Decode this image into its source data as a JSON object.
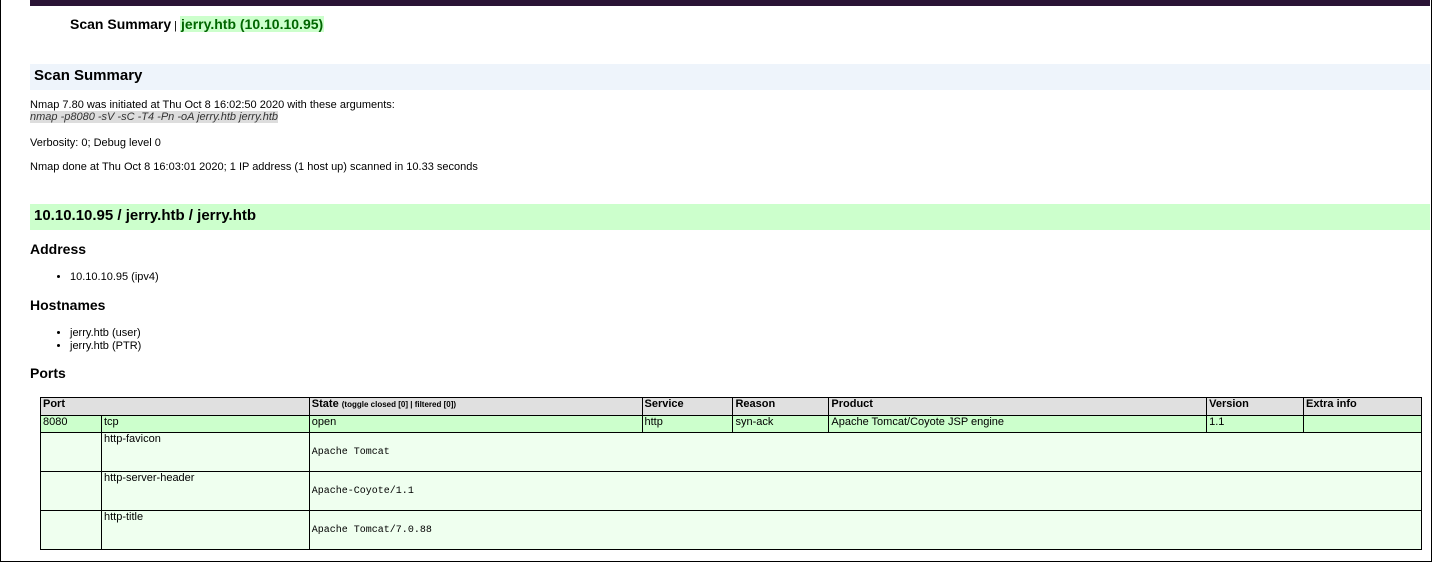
{
  "header": {
    "title": "Scan Summary",
    "separator": "|",
    "host": "jerry.htb (10.10.10.95)"
  },
  "summary": {
    "heading": "Scan Summary",
    "initiated": "Nmap 7.80 was initiated at Thu Oct 8 16:02:50 2020 with these arguments:",
    "arguments": "nmap -p8080 -sV -sC -T4 -Pn -oA jerry.htb jerry.htb",
    "verbosity": "Verbosity: 0; Debug level 0",
    "done": "Nmap done at Thu Oct 8 16:03:01 2020; 1 IP address (1 host up) scanned in 10.33 seconds"
  },
  "host": {
    "heading": "10.10.10.95 / jerry.htb / jerry.htb",
    "address_heading": "Address",
    "addresses": [
      "10.10.10.95 (ipv4)"
    ],
    "hostnames_heading": "Hostnames",
    "hostnames": [
      "jerry.htb (user)",
      "jerry.htb (PTR)"
    ],
    "ports_heading": "Ports"
  },
  "ports_table": {
    "headers": {
      "port": "Port",
      "state": "State",
      "toggle_prefix": "(toggle ",
      "toggle_closed": "closed [0]",
      "toggle_sep": " | ",
      "toggle_filtered": "filtered [0]",
      "toggle_suffix": ")",
      "service": "Service",
      "reason": "Reason",
      "product": "Product",
      "version": "Version",
      "extra": "Extra info"
    },
    "row": {
      "port": "8080",
      "protocol": "tcp",
      "state": "open",
      "service": "http",
      "reason": "syn-ack",
      "product": "Apache Tomcat/Coyote JSP engine",
      "version": "1.1",
      "extra": ""
    },
    "scripts": [
      {
        "name": "http-favicon",
        "output": "Apache Tomcat"
      },
      {
        "name": "http-server-header",
        "output": "Apache-Coyote/1.1"
      },
      {
        "name": "http-title",
        "output": "Apache Tomcat/7.0.88"
      }
    ]
  },
  "colors": {
    "top_bar": "#2a1435",
    "summary_bg": "#eef4fb",
    "host_bg": "#ccffcc",
    "open_row": "#ccffcc",
    "script_row": "#efffef"
  }
}
